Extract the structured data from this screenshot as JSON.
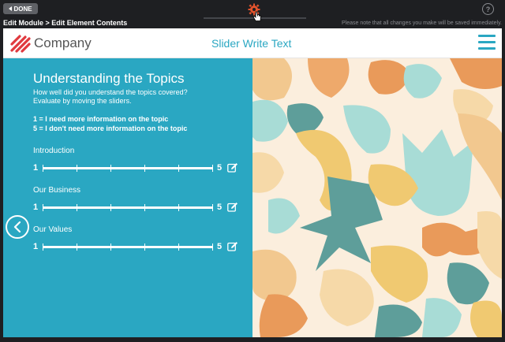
{
  "toolbar": {
    "done_label": "DONE",
    "breadcrumb": "Edit Module > Edit Element Contents",
    "notice": "Please note that all changes you make will be saved immediately.",
    "help_label": "?"
  },
  "header": {
    "company": "Company",
    "title": "Slider Write Text"
  },
  "content": {
    "heading": "Understanding the Topics",
    "subtitle_line1": "How well did you understand the topics covered?",
    "subtitle_line2": "Evaluate by moving the sliders.",
    "key_line1": "1 = I need more information on the topic",
    "key_line2": "5 = I don't need more information on the topic",
    "sliders": [
      {
        "label": "Introduction",
        "min": "1",
        "max": "5"
      },
      {
        "label": "Our Business",
        "min": "1",
        "max": "5"
      },
      {
        "label": "Our Values",
        "min": "1",
        "max": "5"
      }
    ]
  },
  "colors": {
    "accent": "#2aa7c2",
    "logo": "#e0393e",
    "gear": "#e2532d"
  },
  "icons": [
    "gear-icon",
    "help-icon",
    "menu-icon",
    "edit-icon",
    "chevron-left-icon"
  ]
}
